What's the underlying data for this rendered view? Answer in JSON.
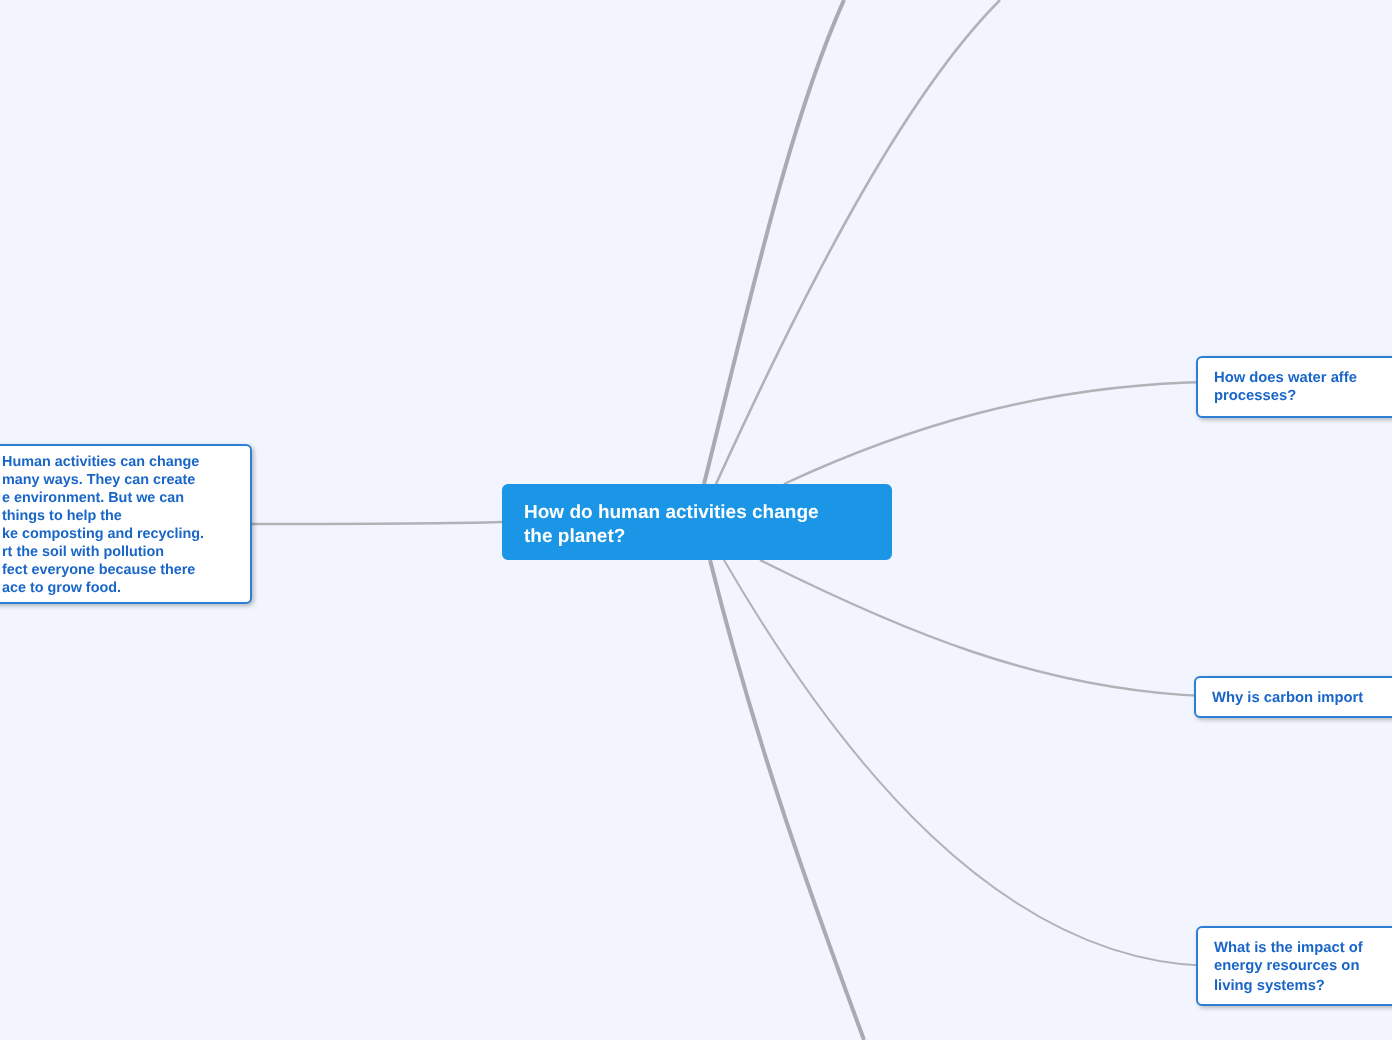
{
  "central_topic": {
    "lines": [
      "How do human activities change",
      "the planet?"
    ]
  },
  "nodes": [
    {
      "kind": "note",
      "lines": [
        "Human activities can change",
        "many ways. They can create",
        "e environment. But we can",
        "things to help the",
        "ke composting and recycling.",
        "rt the soil with pollution",
        "fect everyone because there",
        "ace to grow food."
      ]
    },
    {
      "kind": "topic",
      "lines": [
        "How does water affe",
        "processes?"
      ]
    },
    {
      "kind": "topic",
      "lines": [
        "Why is carbon import"
      ]
    },
    {
      "kind": "topic",
      "lines": [
        "What is the impact of",
        "energy resources on",
        "living systems?"
      ]
    }
  ]
}
